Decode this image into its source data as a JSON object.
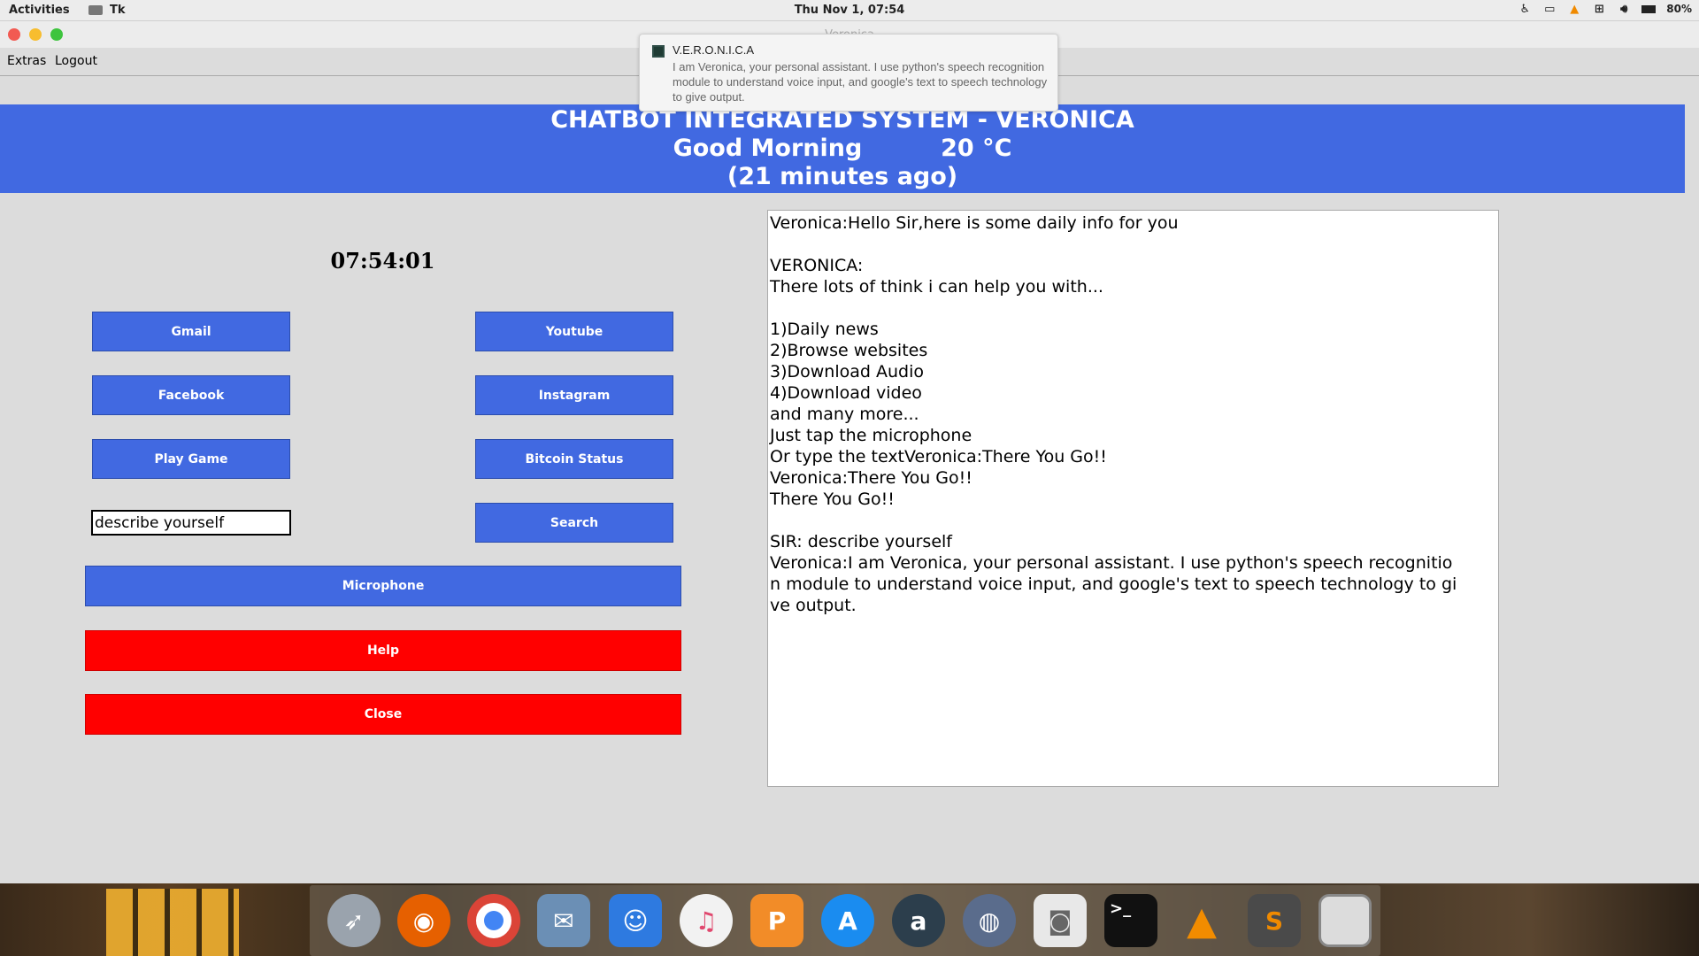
{
  "topbar": {
    "activities": "Activities",
    "app_name": "Tk",
    "clock": "Thu Nov  1, 07:54",
    "battery": "80%"
  },
  "window": {
    "title": "Veronica"
  },
  "menu": {
    "extras": "Extras",
    "logout": "Logout"
  },
  "notification": {
    "title": "V.E.R.O.N.I.C.A",
    "body": "I am Veronica, your personal assistant. I use python's speech recognition module to understand voice input, and google's text to speech technology to give output."
  },
  "banner": {
    "line1": "CHATBOT INTEGRATED SYSTEM - VERONICA",
    "greeting": "Good Morning",
    "temperature": "20 °C",
    "line3": "(21 minutes ago)"
  },
  "timer": "07:54:01",
  "buttons": {
    "gmail": "Gmail",
    "youtube": "Youtube",
    "facebook": "Facebook",
    "instagram": "Instagram",
    "play_game": "Play Game",
    "bitcoin": "Bitcoin Status",
    "search": "Search",
    "microphone": "Microphone",
    "help": "Help",
    "close": "Close"
  },
  "entry_value": "describe yourself",
  "conversation": "Veronica:Hello Sir,here is some daily info for you\n\nVERONICA:\nThere lots of think i can help you with...\n\n1)Daily news\n2)Browse websites\n3)Download Audio\n4)Download video\nand many more...\nJust tap the microphone\nOr type the textVeronica:There You Go!!\nVeronica:There You Go!!\nThere You Go!!\n\nSIR: describe yourself\nVeronica:I am Veronica, your personal assistant. I use python's speech recognitio\nn module to understand voice input, and google's text to speech technology to gi\nve output.",
  "colors": {
    "primary": "#4169e1",
    "danger": "#ff0000"
  },
  "dock_icons": [
    "launchpad-icon",
    "firefox-icon",
    "chrome-icon",
    "preview-icon",
    "finder-icon",
    "itunes-icon",
    "pages-icon",
    "app-store-icon",
    "amazon-icon",
    "network-icon",
    "screenshot-icon",
    "terminal-icon",
    "vlc-icon",
    "sublime-icon",
    "desktop-icon"
  ]
}
